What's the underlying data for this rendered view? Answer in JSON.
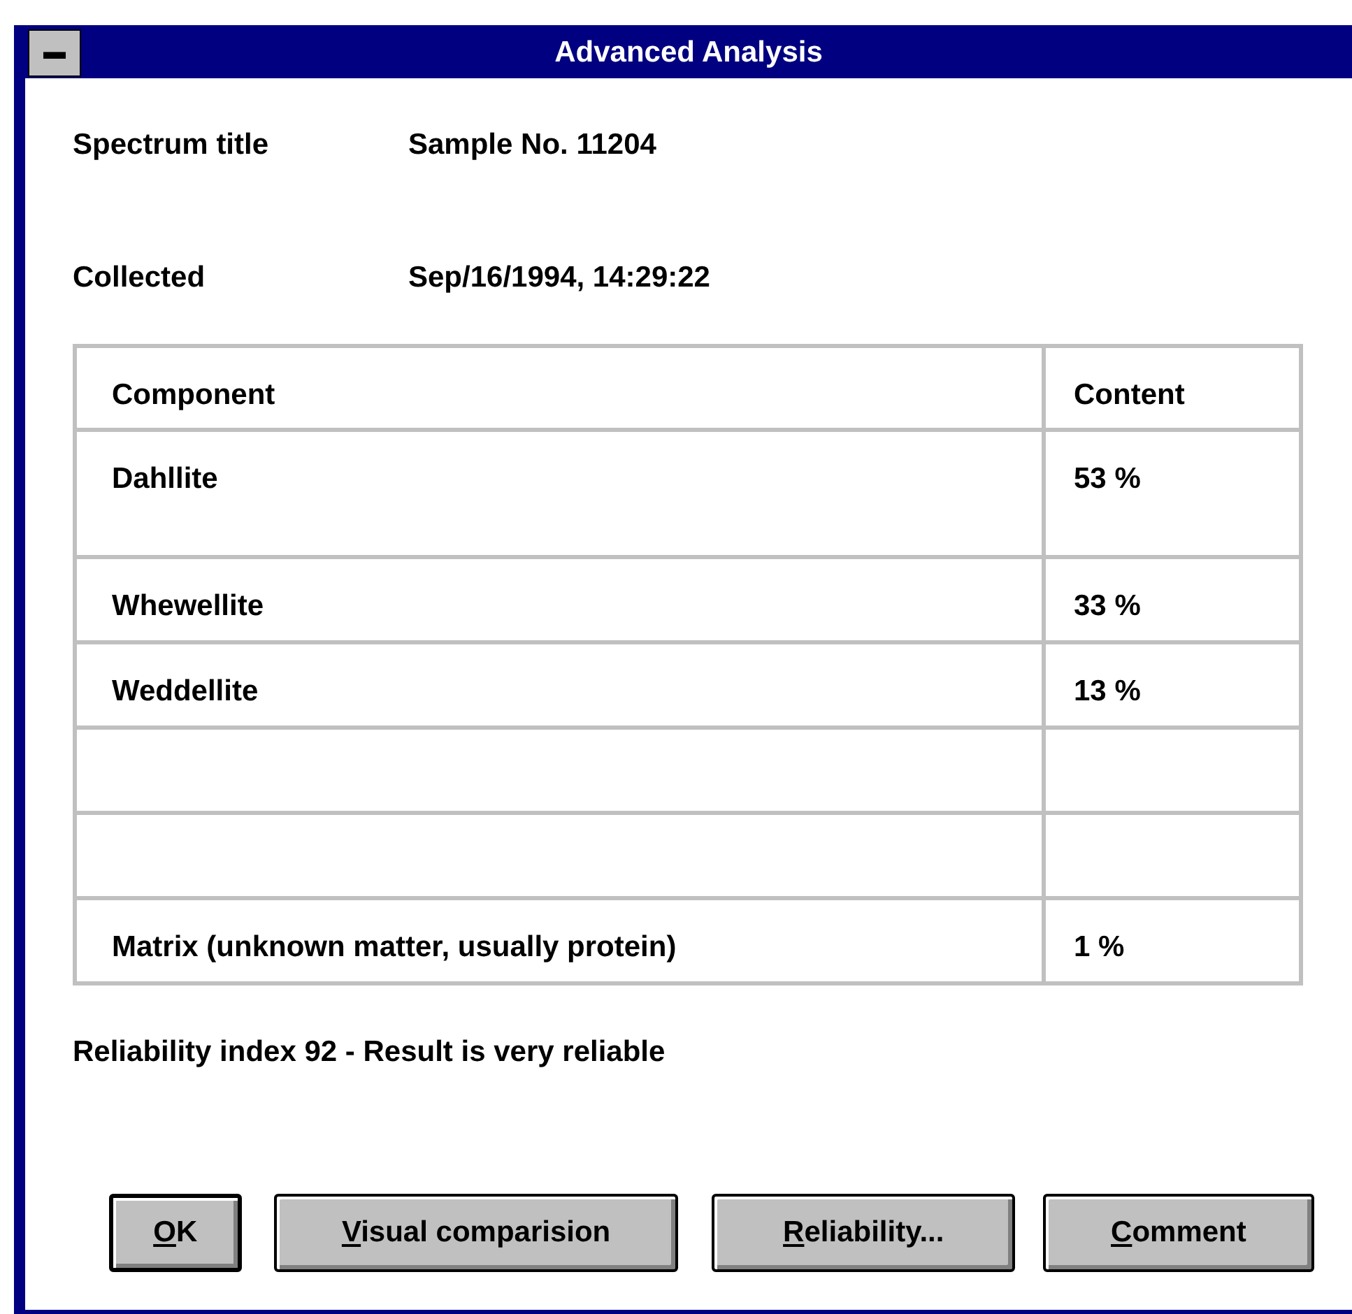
{
  "window": {
    "title": "Advanced Analysis",
    "menu_glyph": "▬"
  },
  "fields": [
    {
      "label": "Spectrum title",
      "value": "Sample No. 11204"
    },
    {
      "label": "Collected",
      "value": "Sep/16/1994, 14:29:22"
    }
  ],
  "table": {
    "columns": [
      "Component",
      "Content"
    ],
    "rows": [
      [
        "Dahllite",
        "53 %"
      ],
      [
        "Whewellite",
        "33 %"
      ],
      [
        "Weddellite",
        "13 %"
      ],
      [
        "",
        ""
      ],
      [
        "",
        ""
      ],
      [
        "Matrix (unknown matter, usually protein)",
        "1 %"
      ]
    ]
  },
  "status": "Reliability index 92 - Result is very reliable",
  "buttons": [
    {
      "label": "OK",
      "default": true
    },
    {
      "label": "Visual comparision",
      "default": false
    },
    {
      "label": "Reliability...",
      "default": false
    },
    {
      "label": "Comment",
      "default": false
    }
  ]
}
